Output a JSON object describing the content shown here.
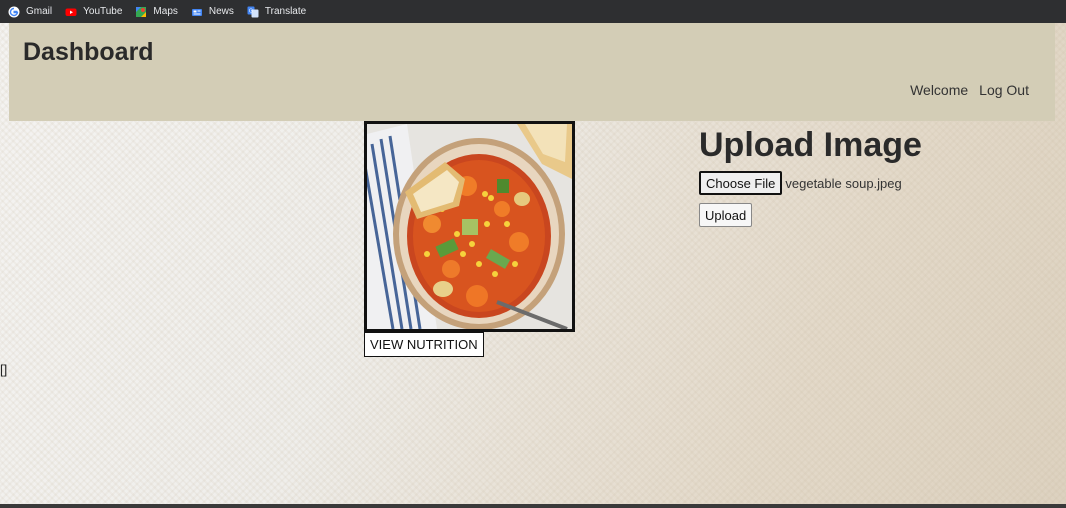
{
  "bookmarks": [
    {
      "label": "Gmail",
      "icon": "google-g-icon"
    },
    {
      "label": "YouTube",
      "icon": "youtube-icon"
    },
    {
      "label": "Maps",
      "icon": "maps-icon"
    },
    {
      "label": "News",
      "icon": "news-icon"
    },
    {
      "label": "Translate",
      "icon": "translate-icon"
    }
  ],
  "header": {
    "brand": "Dashboard",
    "nav": {
      "welcome": "Welcome",
      "logout": "Log Out"
    },
    "background": "#d3cdb6"
  },
  "card": {
    "image_alt": "vegetable soup",
    "button_label": "VIEW NUTRITION"
  },
  "stray_text": "[]",
  "upload": {
    "title": "Upload Image",
    "choose_label": "Choose File",
    "file_name": "vegetable soup.jpeg",
    "upload_label": "Upload"
  }
}
